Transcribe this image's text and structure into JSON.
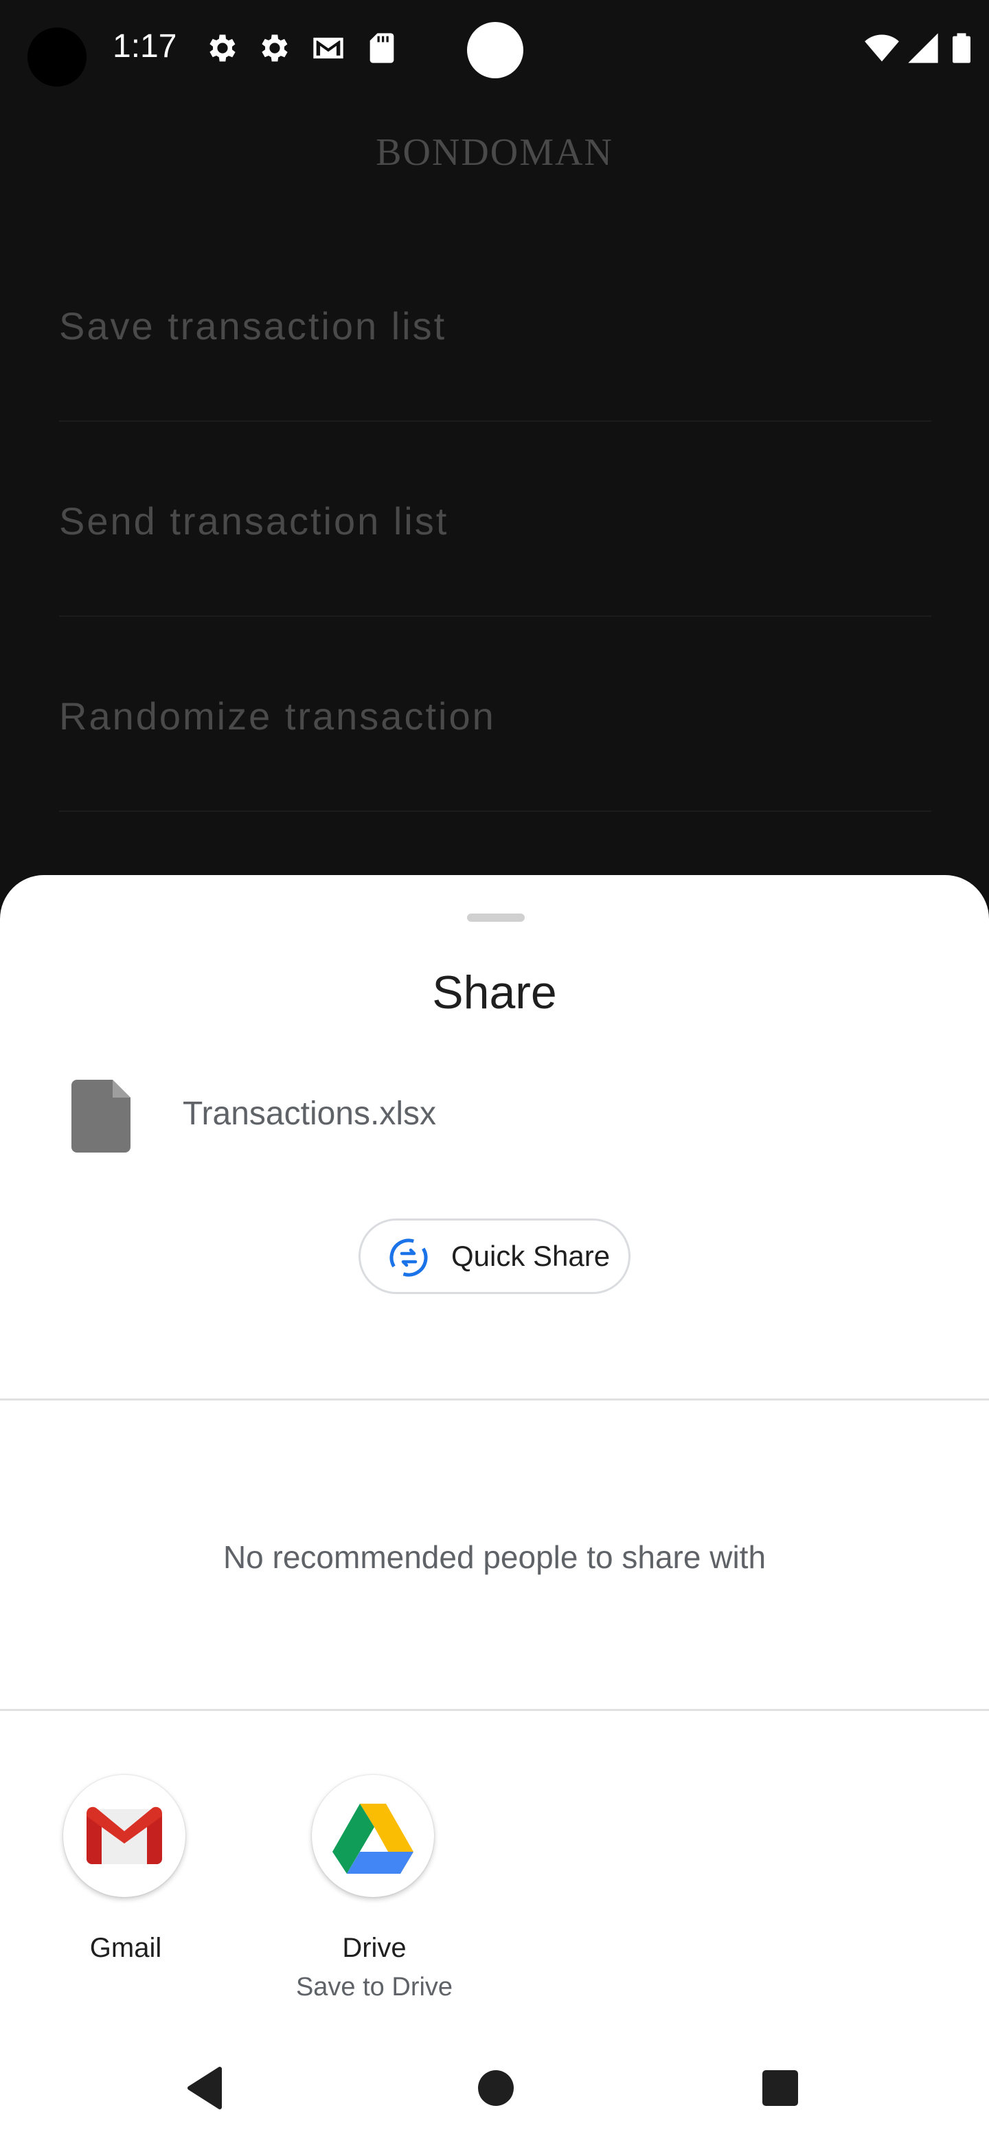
{
  "status_bar": {
    "time": "1:17",
    "icons": [
      "gear-icon",
      "gear-icon",
      "gmail-notification-icon",
      "sd-card-icon",
      "wifi-icon",
      "signal-icon",
      "battery-icon"
    ]
  },
  "background_app": {
    "title": "BONDOMAN",
    "menu_items": [
      {
        "label": "Save transaction list"
      },
      {
        "label": "Send transaction list"
      },
      {
        "label": "Randomize transaction"
      }
    ]
  },
  "share_sheet": {
    "title": "Share",
    "file_name": "Transactions.xlsx",
    "quick_share_label": "Quick Share",
    "empty_people_text": "No recommended people to share with",
    "apps": [
      {
        "label": "Gmail",
        "sublabel": ""
      },
      {
        "label": "Drive",
        "sublabel": "Save to Drive"
      }
    ]
  },
  "colors": {
    "background": "#111111",
    "sheet": "#ffffff",
    "accent_blue": "#1a73e8",
    "dim_text": "#4a4a4a"
  }
}
